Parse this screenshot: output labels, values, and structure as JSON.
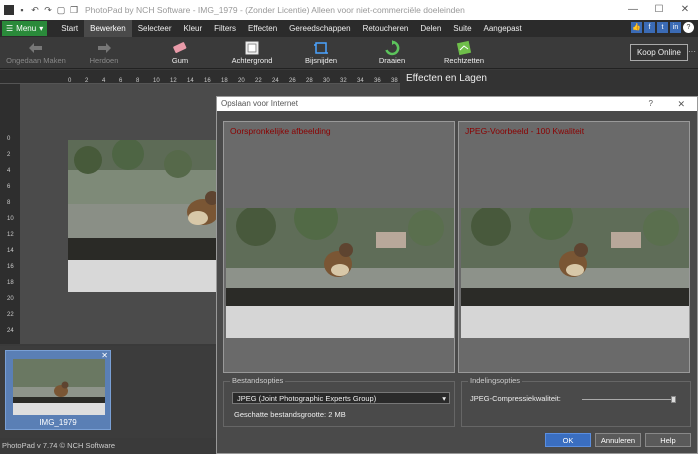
{
  "window": {
    "title": "PhotoPad by NCH Software - IMG_1979 - (Zonder Licentie) Alleen voor niet-commerciële doeleinden"
  },
  "menu": {
    "menu_label": "Menu",
    "tabs": [
      "Start",
      "Bewerken",
      "Selecteer",
      "Kleur",
      "Filters",
      "Effecten",
      "Gereedschappen",
      "Retoucheren",
      "Delen",
      "Suite",
      "Aangepast"
    ]
  },
  "toolbar": {
    "undo": "Ongedaan Maken",
    "redo": "Herdoen",
    "eraser": "Gum",
    "background": "Achtergrond",
    "crop": "Bijsnijden",
    "rotate": "Draaien",
    "straighten": "Rechtzetten",
    "buy": "Koop Online"
  },
  "ruler": {
    "h_ticks": [
      "0",
      "2",
      "4",
      "6",
      "8",
      "10",
      "12",
      "14",
      "16",
      "18",
      "20",
      "22",
      "24",
      "26",
      "28",
      "30",
      "32",
      "34",
      "36",
      "38"
    ],
    "v_ticks": [
      "0",
      "2",
      "4",
      "6",
      "8",
      "10",
      "12",
      "14",
      "16",
      "18",
      "20",
      "22",
      "24"
    ]
  },
  "panel": {
    "effects_title": "Effecten en Lagen"
  },
  "thumbnail": {
    "label": "IMG_1979"
  },
  "status": {
    "text": "PhotoPad v 7.74 © NCH Software"
  },
  "dialog": {
    "title": "Opslaan voor Internet",
    "help_glyph": "?",
    "close_glyph": "✕",
    "original_caption": "Oorspronkelijke afbeelding",
    "preview_caption": "JPEG-Voorbeeld - 100 Kwaliteit",
    "file_options_label": "Bestandsopties",
    "format_value": "JPEG (Joint Photographic Experts Group)",
    "estimated_size": "Geschatte bestandsgrootte: 2 MB",
    "layout_options_label": "Indelingsopties",
    "quality_label": "JPEG-Compressiekwaliteit:",
    "quality_value": 100,
    "ok": "OK",
    "cancel": "Annuleren",
    "help": "Help"
  },
  "colors": {
    "menu_green": "#2a8a3a",
    "caption_red": "#8b0000",
    "ok_blue": "#3a6ec0"
  }
}
